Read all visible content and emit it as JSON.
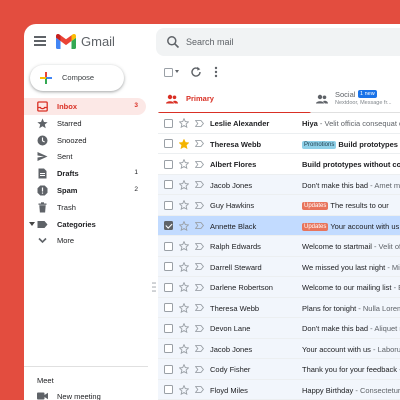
{
  "header": {
    "brand": "Gmail",
    "search_placeholder": "Search mail"
  },
  "sidebar": {
    "compose_label": "Compose",
    "items": [
      {
        "label": "Inbox",
        "count": "3",
        "icon": "inbox-icon"
      },
      {
        "label": "Starred",
        "count": "",
        "icon": "star-icon"
      },
      {
        "label": "Snoozed",
        "count": "",
        "icon": "clock-icon"
      },
      {
        "label": "Sent",
        "count": "",
        "icon": "send-icon"
      },
      {
        "label": "Drafts",
        "count": "1",
        "icon": "draft-icon"
      },
      {
        "label": "Spam",
        "count": "2",
        "icon": "spam-icon"
      },
      {
        "label": "Trash",
        "count": "",
        "icon": "trash-icon"
      },
      {
        "label": "Categories",
        "count": "",
        "icon": "label-icon"
      },
      {
        "label": "More",
        "count": "",
        "icon": "chevron-down-icon"
      }
    ],
    "meet_title": "Meet",
    "meet_item": "New meeting"
  },
  "tabs": {
    "primary": "Primary",
    "social": "Social",
    "social_badge": "1 new",
    "social_sub": "Nextdoor, Message fr..."
  },
  "emails": [
    {
      "sender": "Leslie Alexander",
      "label": "",
      "subject": "Hiya",
      "snippet": " - Velit officia consequat duis"
    },
    {
      "sender": "Theresa Webb",
      "label": "Promotions",
      "subject": "Build prototypes wi",
      "snippet": ""
    },
    {
      "sender": "Albert Flores",
      "label": "",
      "subject": "Build prototypes without code",
      "snippet": ""
    },
    {
      "sender": "Jacob Jones",
      "label": "",
      "subject": "Don't make this bad",
      "snippet": " - Amet minim"
    },
    {
      "sender": "Guy Hawkins",
      "label": "Updates",
      "subject": "The results to our",
      "snippet": ""
    },
    {
      "sender": "Annette Black",
      "label": "Updates",
      "subject": "Your account with us",
      "snippet": ""
    },
    {
      "sender": "Ralph Edwards",
      "label": "",
      "subject": "Welcome to startmail",
      "snippet": " - Velit offic"
    },
    {
      "sender": "Darrell Steward",
      "label": "",
      "subject": "We missed you last night",
      "snippet": " - Minim m"
    },
    {
      "sender": "Darlene Robertson",
      "label": "",
      "subject": "Welcome to our mailing list",
      "snippet": " - Exerci"
    },
    {
      "sender": "Theresa Webb",
      "label": "",
      "subject": "Plans for tonight",
      "snippet": " - Nulla Lorem mollit"
    },
    {
      "sender": "Devon Lane",
      "label": "",
      "subject": "Don't make this bad",
      "snippet": " - Aliquet maecenas"
    },
    {
      "sender": "Jacob Jones",
      "label": "",
      "subject": "Your account with us",
      "snippet": " - Laboru"
    },
    {
      "sender": "Cody Fisher",
      "label": "",
      "subject": "Thank you for your feedback",
      "snippet": " - Volup"
    },
    {
      "sender": "Floyd Miles",
      "label": "",
      "subject": "Happy Birthday",
      "snippet": " - Consectetur ame"
    }
  ],
  "colors": {
    "background": "#e34d3f",
    "accent": "#d93025",
    "selected_row": "#c2dbff",
    "promotions_label": "#8ed0e8",
    "updates_label": "#e8745c"
  }
}
